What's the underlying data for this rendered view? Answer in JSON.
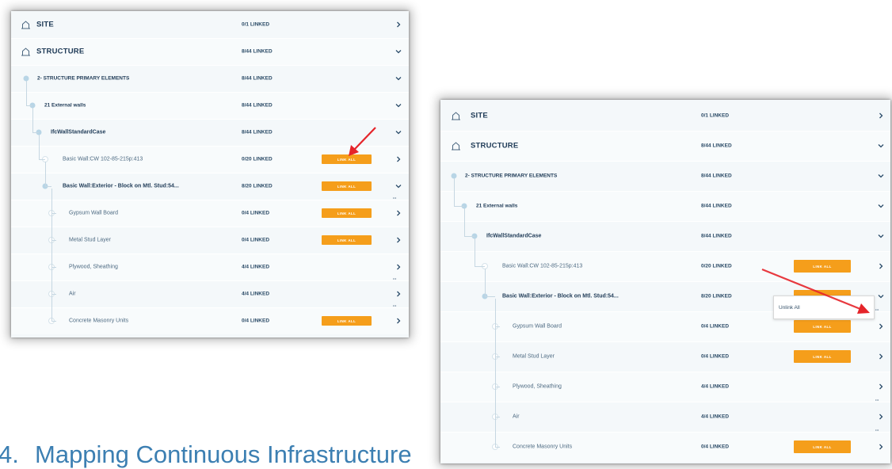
{
  "colors": {
    "accent": "#f59e1b",
    "arrow": "#e5242a",
    "text": "#1f3b57",
    "caption": "#3c7fb2",
    "panel_bg": "#f4f8fa"
  },
  "left_panel": {
    "rows": [
      {
        "label": "SITE",
        "count": "0/1 LINKED",
        "expand": "chevron-right",
        "icon": "building-icon",
        "button": null,
        "menu": false
      },
      {
        "label": "STRUCTURE",
        "count": "8/44 LINKED",
        "expand": "chevron-down",
        "icon": "building-icon",
        "button": null,
        "menu": false
      },
      {
        "label": "2- STRUCTURE PRIMARY ELEMENTS",
        "count": "8/44 LINKED",
        "expand": "chevron-down",
        "button": null,
        "menu": false
      },
      {
        "label": "21 External walls",
        "count": "8/44 LINKED",
        "expand": "chevron-down",
        "button": null,
        "menu": false
      },
      {
        "label": "IfcWallStandardCase",
        "count": "8/44 LINKED",
        "expand": "chevron-down",
        "button": null,
        "menu": false
      },
      {
        "label": "Basic Wall:CW 102-85-215p:413",
        "count": "0/20 LINKED",
        "expand": "chevron-right",
        "button": "LINK ALL",
        "menu": false
      },
      {
        "label": "Basic Wall:Exterior - Block on Mtl. Stud:54...",
        "count": "8/20 LINKED",
        "expand": "chevron-down",
        "button": "LINK ALL",
        "menu": true
      },
      {
        "label": "Gypsum Wall Board",
        "count": "0/4 LINKED",
        "expand": "chevron-right",
        "button": "LINK ALL",
        "menu": false
      },
      {
        "label": "Metal Stud Layer",
        "count": "0/4 LINKED",
        "expand": "chevron-right",
        "button": "LINK ALL",
        "menu": false
      },
      {
        "label": "Plywood, Sheathing",
        "count": "4/4 LINKED",
        "expand": "chevron-right",
        "button": null,
        "menu": true
      },
      {
        "label": "Air",
        "count": "4/4 LINKED",
        "expand": "chevron-right",
        "button": null,
        "menu": true
      },
      {
        "label": "Concrete Masonry Units",
        "count": "0/4 LINKED",
        "expand": "chevron-right",
        "button": "LINK ALL",
        "menu": false
      }
    ]
  },
  "right_panel": {
    "rows": [
      {
        "label": "SITE",
        "count": "0/1 LINKED",
        "expand": "chevron-right",
        "icon": "building-icon",
        "button": null,
        "menu": false
      },
      {
        "label": "STRUCTURE",
        "count": "8/44 LINKED",
        "expand": "chevron-down",
        "icon": "building-icon",
        "button": null,
        "menu": false
      },
      {
        "label": "2- STRUCTURE PRIMARY ELEMENTS",
        "count": "8/44 LINKED",
        "expand": "chevron-down",
        "button": null,
        "menu": false
      },
      {
        "label": "21 External walls",
        "count": "8/44 LINKED",
        "expand": "chevron-down",
        "button": null,
        "menu": false
      },
      {
        "label": "IfcWallStandardCase",
        "count": "8/44 LINKED",
        "expand": "chevron-down",
        "button": null,
        "menu": false
      },
      {
        "label": "Basic Wall:CW 102-85-215p:413",
        "count": "0/20 LINKED",
        "expand": "chevron-right",
        "button": "LINK ALL",
        "menu": false
      },
      {
        "label": "Basic Wall:Exterior - Block on Mtl. Stud:54...",
        "count": "8/20 LINKED",
        "expand": "chevron-down",
        "button": "LINK ALL",
        "menu": true
      },
      {
        "label": "Gypsum Wall Board",
        "count": "0/4 LINKED",
        "expand": "chevron-right",
        "button": "LINK ALL",
        "menu": false
      },
      {
        "label": "Metal Stud Layer",
        "count": "0/4 LINKED",
        "expand": "chevron-right",
        "button": "LINK ALL",
        "menu": false
      },
      {
        "label": "Plywood, Sheathing",
        "count": "4/4 LINKED",
        "expand": "chevron-right",
        "button": null,
        "menu": true
      },
      {
        "label": "Air",
        "count": "4/4 LINKED",
        "expand": "chevron-right",
        "button": null,
        "menu": true
      },
      {
        "label": "Concrete Masonry Units",
        "count": "0/4 LINKED",
        "expand": "chevron-right",
        "button": "LINK ALL",
        "menu": false
      }
    ],
    "popup_label": "Unlink All"
  },
  "caption": {
    "number": "4.",
    "text": "Mapping Continuous Infrastructure"
  }
}
